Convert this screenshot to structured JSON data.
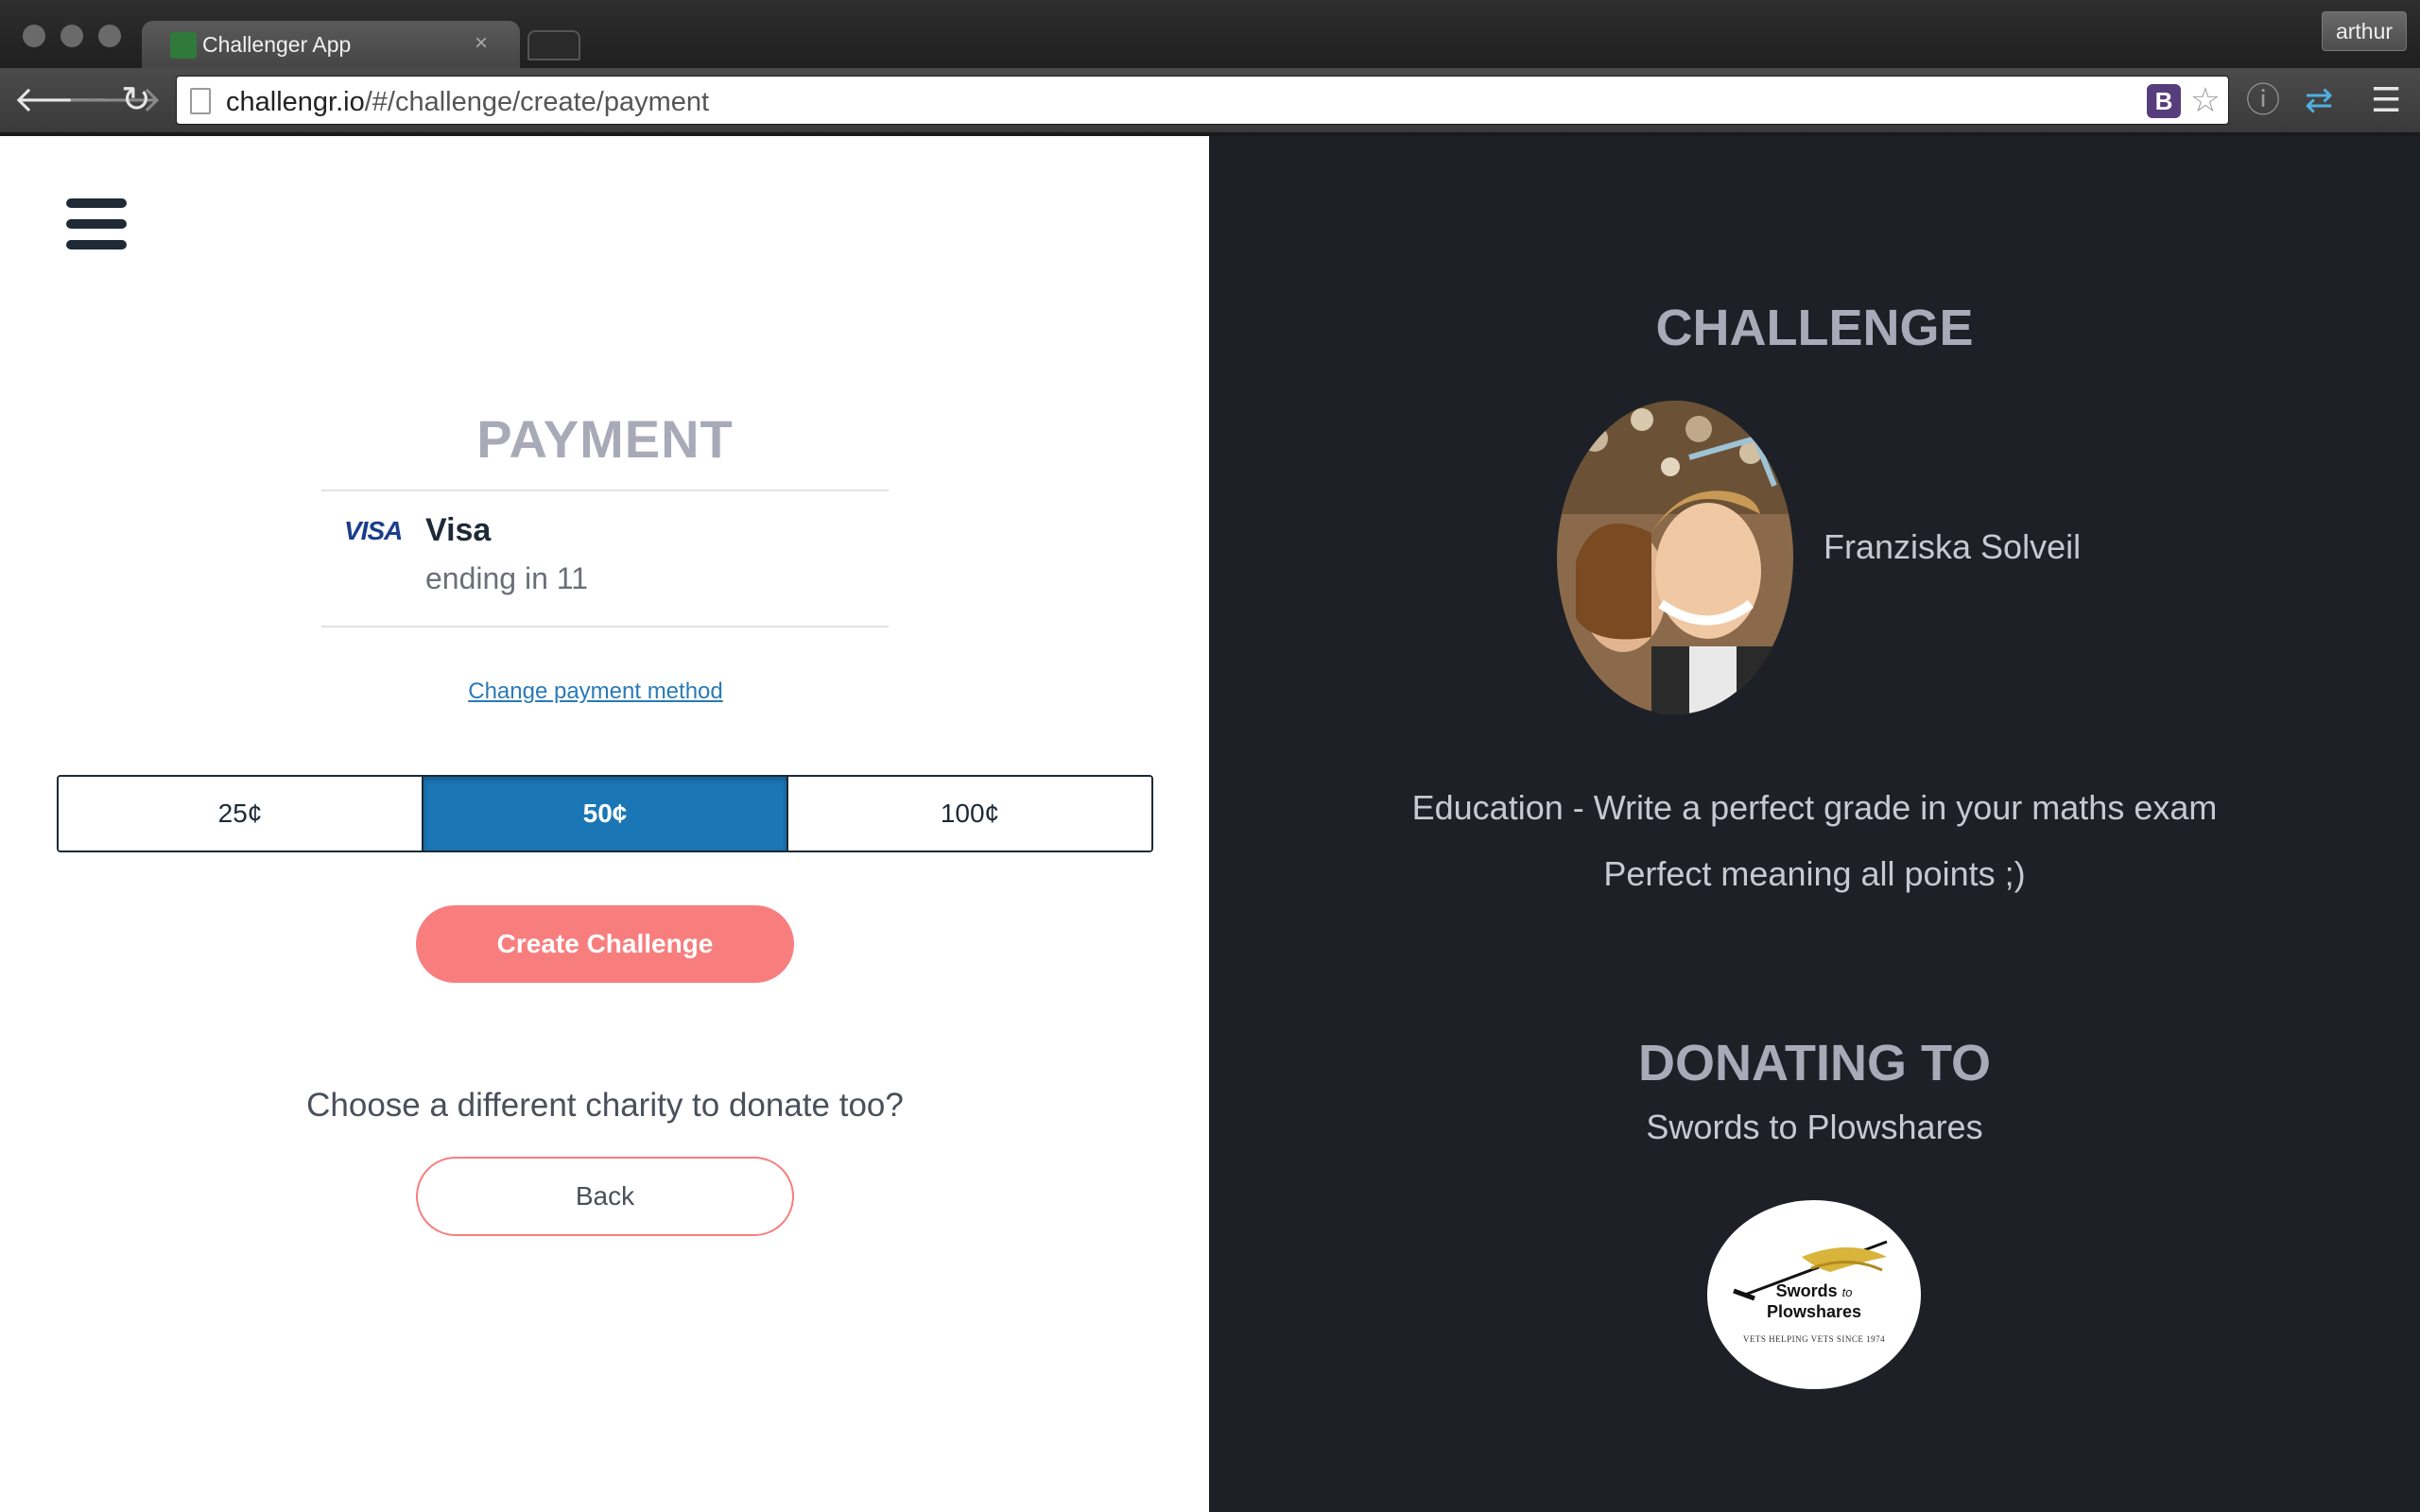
{
  "browser": {
    "tab_title": "Challenger App",
    "tab_close": "×",
    "profile_name": "arthur",
    "url_host": "challengr.io",
    "url_path": "/#/challenge/create/payment",
    "ext_badge": "B"
  },
  "icons": {
    "back": "arrow-left-icon",
    "forward": "arrow-right-icon",
    "reload": "reload-icon",
    "bookmark": "star-icon",
    "info": "info-icon",
    "extension": "extension-icon",
    "menu": "hamburger-menu-icon"
  },
  "payment": {
    "title": "PAYMENT",
    "card_logo": "VISA",
    "card_brand": "Visa",
    "card_ending": "ending in 11",
    "change_link": "Change payment method",
    "amounts": [
      {
        "label": "25¢",
        "active": false
      },
      {
        "label": "50¢",
        "active": true
      },
      {
        "label": "100¢",
        "active": false
      }
    ],
    "create_button": "Create Challenge",
    "charity_question": "Choose a different charity to donate too?",
    "back_button": "Back"
  },
  "challenge": {
    "title": "CHALLENGE",
    "user_name": "Franziska Solveil",
    "description_line1": "Education - Write a perfect grade in your maths exam",
    "description_line2": "Perfect meaning all points ;)"
  },
  "donation": {
    "title": "DONATING TO",
    "charity_name": "Swords to Plowshares",
    "logo_line1": "Swords",
    "logo_to": "to",
    "logo_line2": "Plowshares",
    "logo_tagline": "VETS HELPING VETS SINCE 1974"
  },
  "colors": {
    "accent_blue": "#1b76b5",
    "accent_coral": "#f87e7e",
    "dark_panel": "#1d2127",
    "heading_gray": "#a9aab8"
  }
}
